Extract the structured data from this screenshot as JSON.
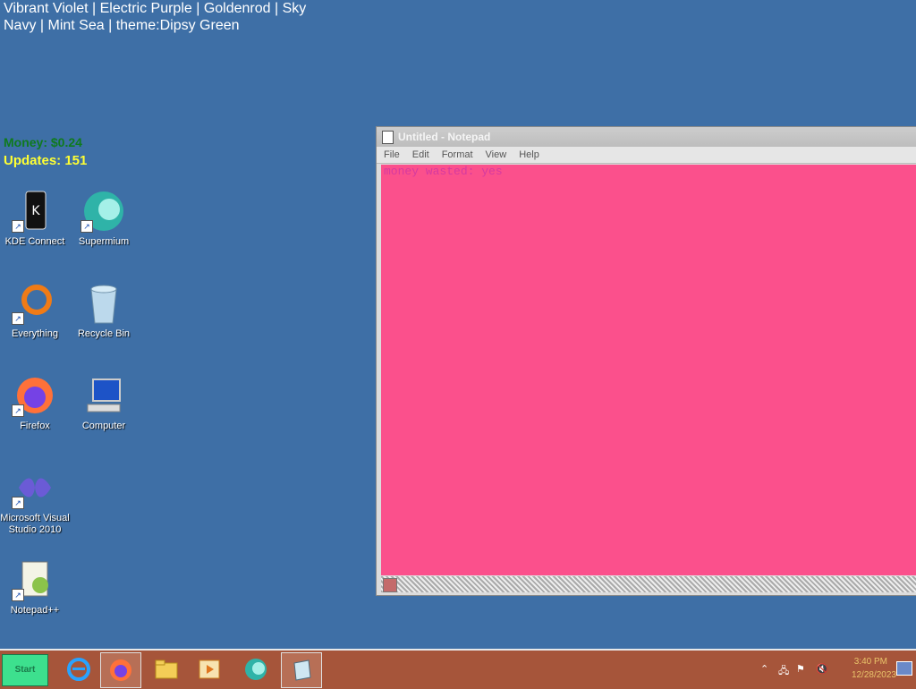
{
  "overlay": {
    "line1": "Vibrant Violet | Electric Purple | Goldenrod | Sky",
    "line2": "Navy | Mint Sea | theme:Dipsy Green",
    "money": "Money: $0.24",
    "updates": "Updates: 151"
  },
  "desktop_icons": [
    {
      "label": "KDE Connect",
      "icon": "kde-connect-icon"
    },
    {
      "label": "Supermium",
      "icon": "supermium-icon"
    },
    {
      "label": "Everything",
      "icon": "everything-icon"
    },
    {
      "label": "Recycle Bin",
      "icon": "recycle-bin-icon"
    },
    {
      "label": "Firefox",
      "icon": "firefox-icon"
    },
    {
      "label": "Computer",
      "icon": "computer-icon"
    },
    {
      "label": "Microsoft Visual Studio 2010",
      "icon": "visual-studio-icon"
    },
    {
      "label": "Notepad++",
      "icon": "notepad-plus-plus-icon"
    }
  ],
  "notepad": {
    "title": "Untitled - Notepad",
    "menu": [
      "File",
      "Edit",
      "Format",
      "View",
      "Help"
    ],
    "content": "money wasted: yes",
    "background": "#fb508c"
  },
  "taskbar": {
    "start_label": "Start",
    "pinned": [
      "internet-explorer-icon",
      "firefox-icon",
      "file-explorer-icon",
      "media-player-icon",
      "supermium-icon",
      "notepad-icon"
    ],
    "clock_time": "3:40 PM",
    "clock_date": "12/28/2023"
  },
  "colors": {
    "desktop": "#3e6fa6",
    "taskbar": "#a6553a",
    "start_button": "#3de08e",
    "money_text": "#0f7a1e",
    "updates_text": "#ffff33"
  }
}
